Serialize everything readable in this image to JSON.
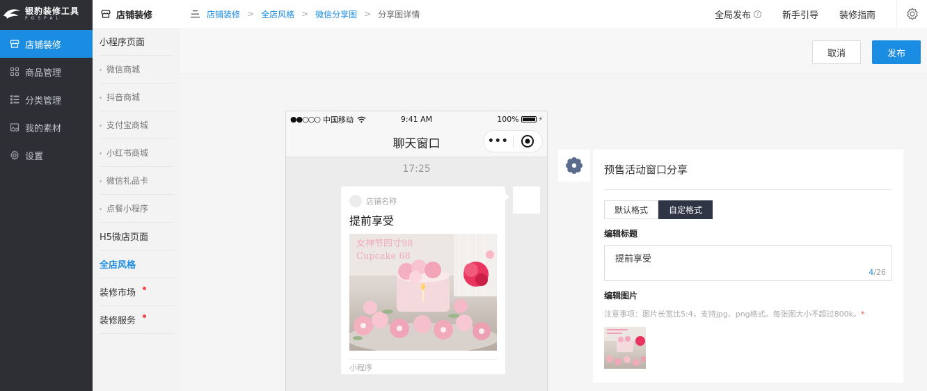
{
  "brand": {
    "name": "银豹装修工具",
    "sub": "POSPAL"
  },
  "left_nav": [
    {
      "label": "店铺装修",
      "icon": "store-icon",
      "active": true
    },
    {
      "label": "商品管理",
      "icon": "grid-icon",
      "active": false
    },
    {
      "label": "分类管理",
      "icon": "list-icon",
      "active": false
    },
    {
      "label": "我的素材",
      "icon": "image-icon",
      "active": false
    },
    {
      "label": "设置",
      "icon": "settings-icon",
      "active": false
    }
  ],
  "sub_nav": {
    "header": "店铺装修",
    "items": [
      {
        "label": "小程序页面",
        "type": "group"
      },
      {
        "label": "微信商城",
        "type": "sub"
      },
      {
        "label": "抖音商城",
        "type": "sub"
      },
      {
        "label": "支付宝商城",
        "type": "sub"
      },
      {
        "label": "小红书商城",
        "type": "sub"
      },
      {
        "label": "微信礼品卡",
        "type": "sub"
      },
      {
        "label": "点餐小程序",
        "type": "sub"
      },
      {
        "label": "H5微店页面",
        "type": "group"
      },
      {
        "label": "全店风格",
        "type": "active"
      },
      {
        "label": "装修市场",
        "type": "dot"
      },
      {
        "label": "装修服务",
        "type": "dot"
      }
    ]
  },
  "breadcrumb": [
    "店铺装修",
    "全店风格",
    "微信分享图",
    "分享图详情"
  ],
  "top_right": {
    "publish_all": "全局发布",
    "guide": "新手引导",
    "manual": "装修指南"
  },
  "actions": {
    "cancel": "取消",
    "publish": "发布"
  },
  "phone": {
    "carrier": "中国移动",
    "time": "9:41 AM",
    "battery": "100%",
    "nav_title": "聊天窗口",
    "chat_time": "17:25",
    "card": {
      "shop_name": "店铺名称",
      "title": "提前享受",
      "image_text": [
        "女神节四寸98",
        "Cupcake 68"
      ],
      "footer": "小程序"
    }
  },
  "panel": {
    "title": "预售活动窗口分享",
    "tabs": [
      {
        "label": "默认格式",
        "on": false
      },
      {
        "label": "自定格式",
        "on": true
      }
    ],
    "edit_title_label": "编辑标题",
    "title_value": "提前享受",
    "count_current": "4",
    "count_max": "/26",
    "edit_image_label": "编辑图片",
    "note": "注意事项：图片长宽比5:4，支持jpg、png格式。每张图大小不超过800k。",
    "note_star": "*"
  }
}
